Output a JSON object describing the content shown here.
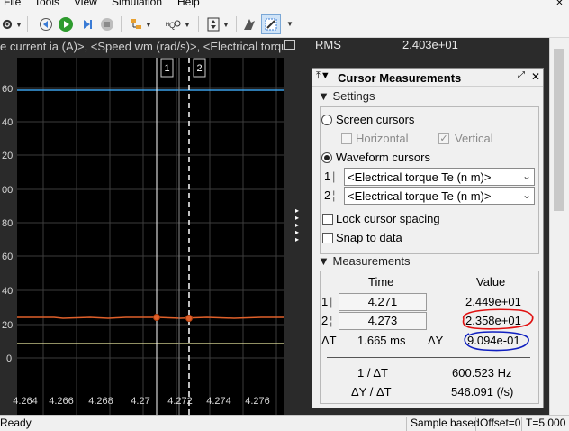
{
  "menu": [
    "File",
    "Tools",
    "View",
    "Simulation",
    "Help"
  ],
  "toolbar": {
    "icons": [
      "settings-icon",
      "step-back-icon",
      "run-icon",
      "step-forward-icon",
      "stop-icon",
      "highlight-icon",
      "zoom-icon",
      "scale-axes-icon",
      "cursor-measure-icon",
      "edit-icon"
    ]
  },
  "plot": {
    "title": "e current ia (A)>, <Speed wm (rad/s)>, <Electrical torqu",
    "background": "#000000",
    "y_ticks": [
      "60",
      "40",
      "20",
      "00",
      "80",
      "60",
      "40",
      "20",
      "0"
    ],
    "x_ticks": [
      "4.264",
      "4.266",
      "4.268",
      "4.27",
      "4.272",
      "4.274",
      "4.276"
    ],
    "cursor1_label": "1",
    "cursor2_label": "2",
    "colors": {
      "blue_line": "#3aa0e8",
      "orange_line": "#e0602a",
      "yellow_line": "#e8e6a0",
      "grid": "#3c3c3c"
    }
  },
  "rms": {
    "label": "RMS",
    "value": "2.403e+01"
  },
  "cursor_panel": {
    "title": "Cursor Measurements",
    "settings_label": "Settings",
    "screen_cursors": "Screen cursors",
    "horizontal": "Horizontal",
    "vertical": "Vertical",
    "waveform_cursors": "Waveform cursors",
    "cursor1_index": "1",
    "cursor2_index": "2",
    "cursor1_signal": "<Electrical torque Te (n m)>",
    "cursor2_signal": "<Electrical torque Te (n m)>",
    "lock_spacing": "Lock cursor spacing",
    "snap_to_data": "Snap to data",
    "measurements_label": "Measurements",
    "time_header": "Time",
    "value_header": "Value",
    "row1_index": "1",
    "row2_index": "2",
    "time1": "4.271",
    "time2": "4.273",
    "value1": "2.449e+01",
    "value2": "2.358e+01",
    "delta_t_label": "ΔT",
    "delta_t": "1.665 ms",
    "delta_y_label": "ΔY",
    "delta_y": "9.094e-01",
    "inv_dt_label": "1 / ΔT",
    "inv_dt": "600.523 Hz",
    "dy_dt_label": "ΔY / ΔT",
    "dy_dt": "546.091 (/s)"
  },
  "status": {
    "left": "Ready",
    "mode": "Sample based",
    "offset": "Offset=0",
    "time": "T=5.000"
  }
}
